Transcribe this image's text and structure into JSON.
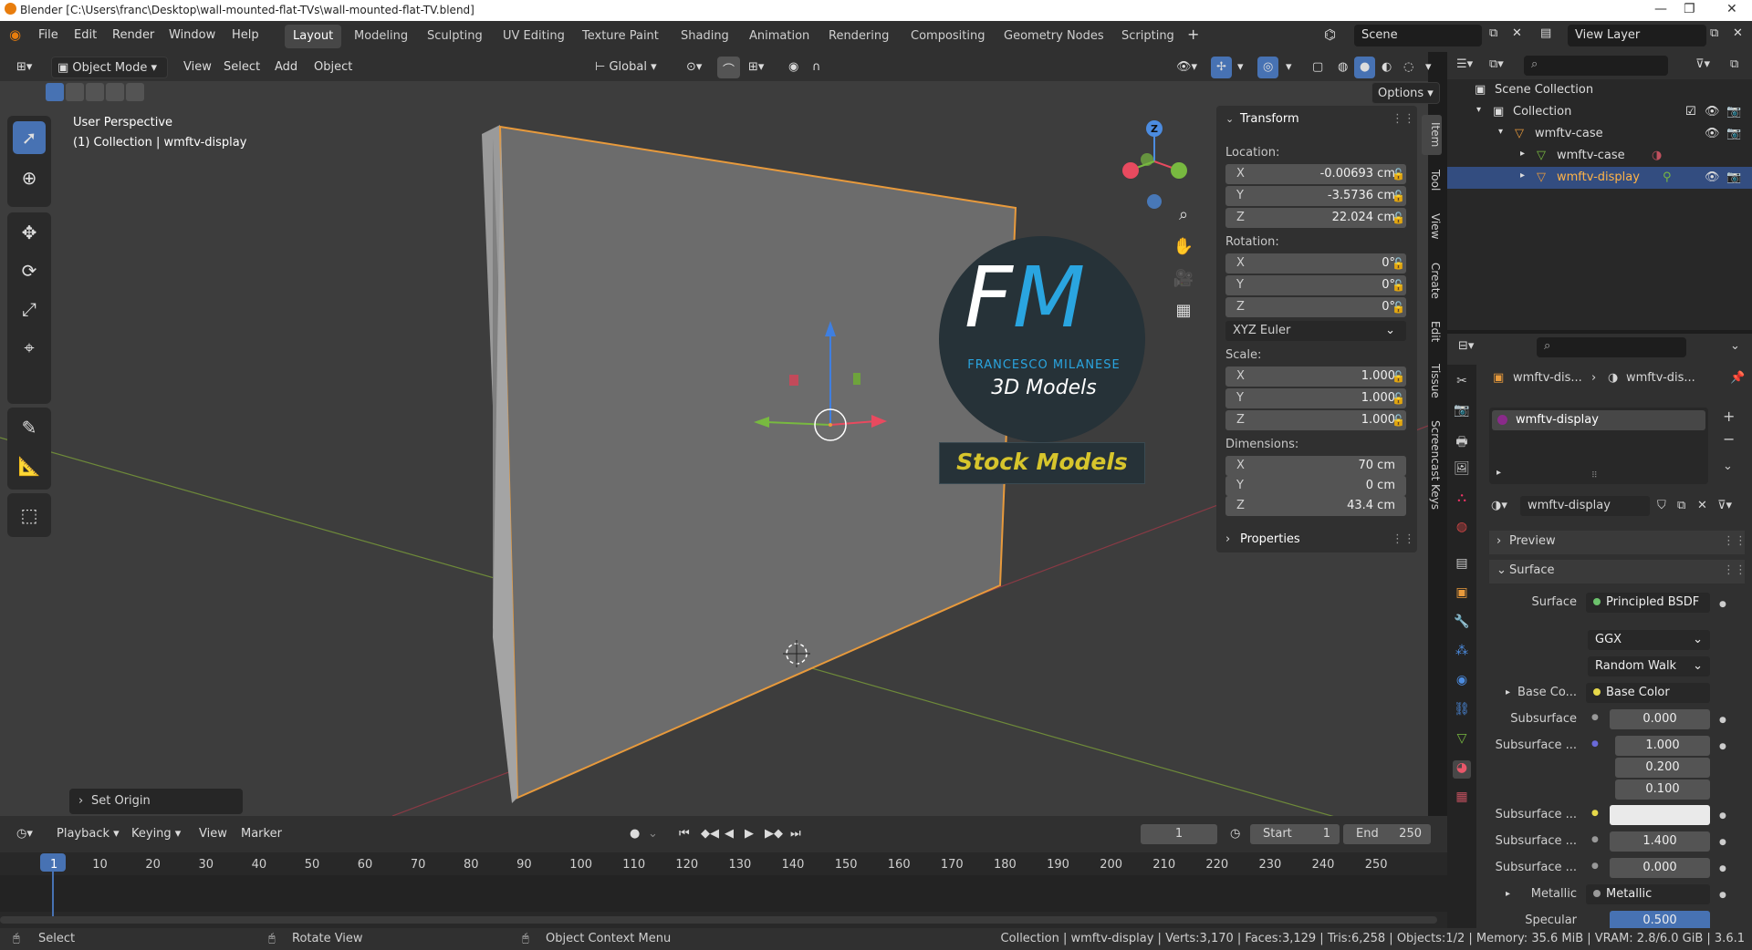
{
  "window": {
    "title": "Blender [C:\\Users\\franc\\Desktop\\wall-mounted-flat-TVs\\wall-mounted-flat-TV.blend]"
  },
  "menu": [
    "File",
    "Edit",
    "Render",
    "Window",
    "Help"
  ],
  "workspaces": [
    "Layout",
    "Modeling",
    "Sculpting",
    "UV Editing",
    "Texture Paint",
    "Shading",
    "Animation",
    "Rendering",
    "Compositing",
    "Geometry Nodes",
    "Scripting"
  ],
  "scene": {
    "name": "Scene",
    "view_layer": "View Layer"
  },
  "viewport_header": {
    "mode": "Object Mode",
    "menus": [
      "View",
      "Select",
      "Add",
      "Object"
    ],
    "orientation": "Global",
    "options": "Options"
  },
  "viewport": {
    "perspective": "User Perspective",
    "collection_info": "(1) Collection | wmftv-display",
    "gizmo": {
      "z": "Z",
      "colors": {
        "x": "#e84a5f",
        "y": "#78b940",
        "z": "#4c8ce0"
      }
    },
    "operator_panel": "Set Origin"
  },
  "watermark": {
    "initials_f": "F",
    "initials_m": "M",
    "line1": "FRANCESCO MILANESE",
    "line2": "3D Models",
    "line3": "Stock Models"
  },
  "npanel": {
    "tabs": [
      "Item",
      "Tool",
      "View",
      "Create",
      "Edit",
      "Tissue",
      "Screencast Keys"
    ],
    "transform_title": "Transform",
    "location_label": "Location:",
    "location": [
      {
        "axis": "X",
        "value": "-0.00693 cm"
      },
      {
        "axis": "Y",
        "value": "-3.5736 cm"
      },
      {
        "axis": "Z",
        "value": "22.024 cm"
      }
    ],
    "rotation_label": "Rotation:",
    "rotation": [
      {
        "axis": "X",
        "value": "0°"
      },
      {
        "axis": "Y",
        "value": "0°"
      },
      {
        "axis": "Z",
        "value": "0°"
      }
    ],
    "rotation_mode": "XYZ Euler",
    "scale_label": "Scale:",
    "scale": [
      {
        "axis": "X",
        "value": "1.000"
      },
      {
        "axis": "Y",
        "value": "1.000"
      },
      {
        "axis": "Z",
        "value": "1.000"
      }
    ],
    "dimensions_label": "Dimensions:",
    "dimensions": [
      {
        "axis": "X",
        "value": "70 cm"
      },
      {
        "axis": "Y",
        "value": "0 cm"
      },
      {
        "axis": "Z",
        "value": "43.4 cm"
      }
    ],
    "properties_title": "Properties"
  },
  "outliner": {
    "scene_collection": "Scene Collection",
    "collection": "Collection",
    "items": [
      "wmftv-case",
      "wmftv-case",
      "wmftv-display"
    ]
  },
  "properties": {
    "breadcrumb_object": "wmftv-dis...",
    "breadcrumb_material": "wmftv-dis...",
    "material_slot": "wmftv-display",
    "material_name": "wmftv-display",
    "preview": "Preview",
    "surface_panel": "Surface",
    "surface_label": "Surface",
    "surface_shader": "Principled BSDF",
    "distribution": "GGX",
    "subsurface_method": "Random Walk",
    "base_color_label": "Base Co...",
    "base_color_value": "Base Color",
    "subsurface_label": "Subsurface",
    "subsurface_value": "0.000",
    "subsurface_radius_label": "Subsurface ...",
    "subsurface_radius": [
      "1.000",
      "0.200",
      "0.100"
    ],
    "subsurface_color_label": "Subsurface ...",
    "subsurface_ior_label": "Subsurface ...",
    "subsurface_ior": "1.400",
    "subsurface_aniso_label": "Subsurface ...",
    "subsurface_aniso": "0.000",
    "metallic_label": "Metallic",
    "metallic_value": "Metallic",
    "specular_label": "Specular",
    "specular_value": "0.500"
  },
  "timeline": {
    "menus": [
      "Playback",
      "Keying",
      "View",
      "Marker"
    ],
    "current_frame": "1",
    "start_label": "Start",
    "start": "1",
    "end_label": "End",
    "end": "250",
    "ticks": [
      "1",
      "10",
      "20",
      "30",
      "40",
      "50",
      "60",
      "70",
      "80",
      "90",
      "100",
      "110",
      "120",
      "130",
      "140",
      "150",
      "160",
      "170",
      "180",
      "190",
      "200",
      "210",
      "220",
      "230",
      "240",
      "250"
    ]
  },
  "statusbar": {
    "select": "Select",
    "rotate": "Rotate View",
    "context": "Object Context Menu",
    "stats": "Collection | wmftv-display | Verts:3,170 | Faces:3,129 | Tris:6,258 | Objects:1/2 | Memory: 35.6 MiB | VRAM: 2.8/6.0 GiB | 3.6.1"
  },
  "colors": {
    "accent": "#4772b3",
    "selection": "#e89a3c",
    "header": "#303030",
    "viewport": "#3d3d3d"
  }
}
